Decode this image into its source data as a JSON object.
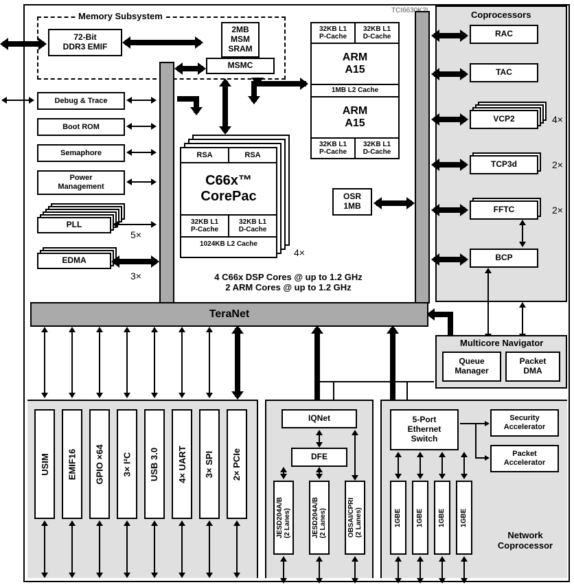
{
  "chip": "TCI6630K2L",
  "memory_subsystem": {
    "title": "Memory Subsystem",
    "emif": "72-Bit\nDDR3 EMIF",
    "msm": "2MB\nMSM\nSRAM",
    "msmc": "MSMC"
  },
  "left_blocks": {
    "debug": "Debug & Trace",
    "boot": "Boot ROM",
    "sema": "Semaphore",
    "power": "Power\nManagement",
    "pll": "PLL",
    "pll_mult": "5×",
    "edma": "EDMA",
    "edma_mult": "3×"
  },
  "corepac": {
    "rsa1": "RSA",
    "rsa2": "RSA",
    "title": "C66x™\nCorePac",
    "l1p": "32KB L1\nP-Cache",
    "l1d": "32KB L1\nD-Cache",
    "l2": "1024KB L2 Cache",
    "mult": "4×"
  },
  "arm": {
    "top_l1p": "32KB L1\nP-Cache",
    "top_l1d": "32KB L1\nD-Cache",
    "name1": "ARM\nA15",
    "l2": "1MB L2 Cache",
    "name2": "ARM\nA15",
    "bot_l1p": "32KB L1\nP-Cache",
    "bot_l1d": "32KB L1\nD-Cache"
  },
  "osr": "OSR\n1MB",
  "core_summary": "4 C66x DSP Cores @ up to 1.2 GHz\n2 ARM Cores @ up to 1.2 GHz",
  "teranet": "TeraNet",
  "coproc": {
    "title": "Coprocessors",
    "rac": "RAC",
    "tac": "TAC",
    "vcp2": "VCP2",
    "vcp2_mult": "4×",
    "tcp3d": "TCP3d",
    "tcp3d_mult": "2×",
    "fftc": "FFTC",
    "fftc_mult": "2×",
    "bcp": "BCP"
  },
  "navigator": {
    "title": "Multicore Navigator",
    "qm": "Queue\nManager",
    "pdma": "Packet\nDMA"
  },
  "io": {
    "usim": "USIM",
    "emif16": "EMIF16",
    "gpio": "GPIO ×64",
    "i2c": "3× I²C",
    "usb": "USB 3.0",
    "uart": "4× UART",
    "spi": "3× SPI",
    "pcie": "2× PCIe"
  },
  "iqnet": {
    "iqnet": "IQNet",
    "dfe": "DFE",
    "jesd1": "JESD204A/B\n(2 Lanes)",
    "jesd2": "JESD204A/B\n(2 Lanes)",
    "obsai": "OBSAI/CPRI\n(2 Lanes)"
  },
  "netcp": {
    "switch": "5-Port\nEthernet\nSwitch",
    "gbe": "1GBE",
    "sec": "Security\nAccelerator",
    "pkt": "Packet\nAccelerator",
    "title": "Network\nCoprocessor"
  }
}
